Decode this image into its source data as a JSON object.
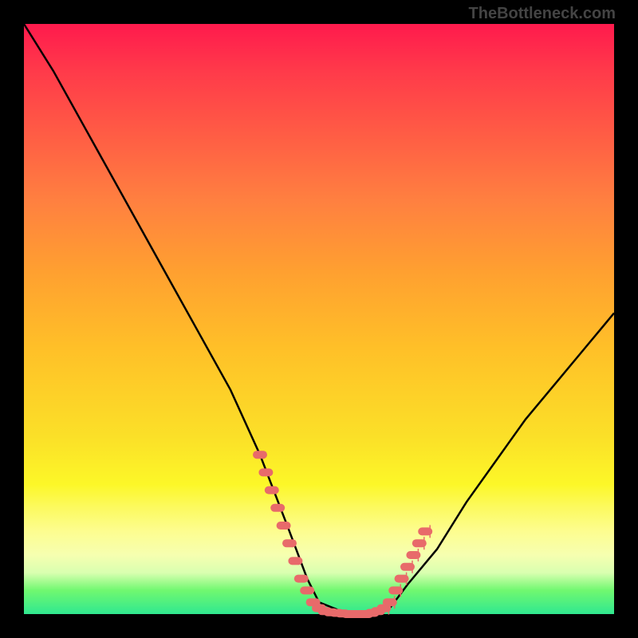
{
  "watermark": "TheBottleneck.com",
  "chart_data": {
    "type": "line",
    "title": "",
    "xlabel": "",
    "ylabel": "",
    "xlim": [
      0,
      100
    ],
    "ylim": [
      0,
      100
    ],
    "series": [
      {
        "name": "curve",
        "x": [
          0,
          5,
          10,
          15,
          20,
          25,
          30,
          35,
          40,
          45,
          48,
          50,
          55,
          58,
          60,
          62,
          65,
          70,
          75,
          80,
          85,
          90,
          95,
          100
        ],
        "y": [
          100,
          92,
          83,
          74,
          65,
          56,
          47,
          38,
          27,
          14,
          6,
          2,
          0,
          0,
          0,
          1,
          5,
          11,
          19,
          26,
          33,
          39,
          45,
          51
        ]
      }
    ],
    "marker_clusters": [
      {
        "name": "left-cluster",
        "x": [
          40,
          41,
          42,
          43,
          44,
          45,
          46,
          47,
          48,
          49,
          50,
          51,
          52
        ],
        "y": [
          27,
          24,
          21,
          18,
          15,
          12,
          9,
          6,
          4,
          2,
          1,
          0.5,
          0.3
        ]
      },
      {
        "name": "bottom-cluster",
        "x": [
          53,
          54,
          55,
          56,
          57,
          58,
          59,
          60
        ],
        "y": [
          0.2,
          0.1,
          0,
          0,
          0,
          0,
          0.2,
          0.5
        ]
      },
      {
        "name": "right-cluster",
        "x": [
          61,
          62,
          63,
          64,
          65,
          66,
          67,
          68
        ],
        "y": [
          1,
          2,
          4,
          6,
          8,
          10,
          12,
          14
        ]
      }
    ],
    "background_gradient": {
      "top": "#ff1a4d",
      "mid": "#fbe028",
      "bottom": "#30e890"
    }
  }
}
